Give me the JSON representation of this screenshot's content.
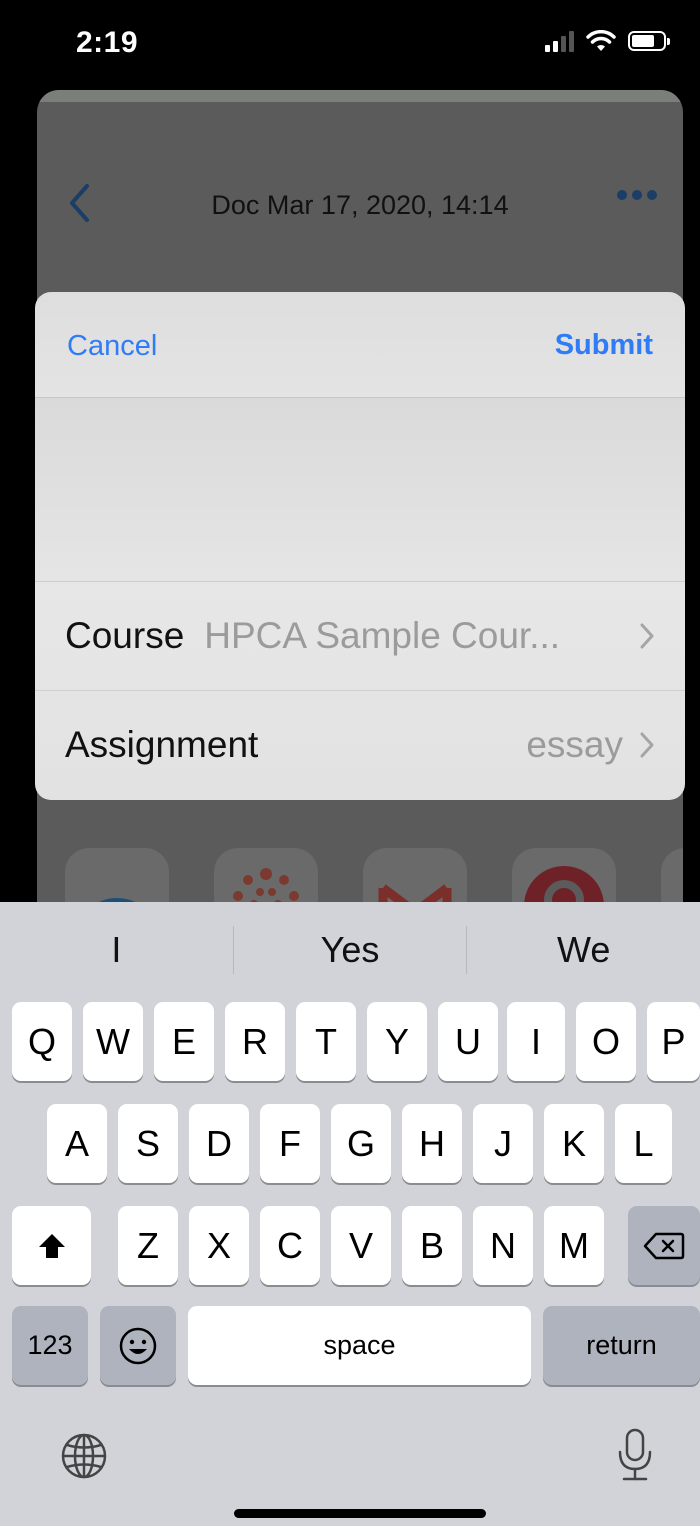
{
  "status_bar": {
    "time": "2:19",
    "signal_icon": "cellular-signal-icon",
    "wifi_icon": "wifi-icon",
    "battery_icon": "battery-icon"
  },
  "app": {
    "back_icon": "chevron-left-icon",
    "title": "Doc Mar 17, 2020, 14:14",
    "more_icon": "more-horizontal-icon",
    "share_apps": [
      "fingerprint-app-icon",
      "canvas-app-icon",
      "gmail-app-icon",
      "pinterest-app-icon",
      "chrome-app-icon"
    ]
  },
  "dialog": {
    "cancel_label": "Cancel",
    "submit_label": "Submit",
    "rows": [
      {
        "label": "Course",
        "value": "HPCA Sample Cour..."
      },
      {
        "label": "Assignment",
        "value": "essay"
      }
    ]
  },
  "keyboard": {
    "suggestions": [
      "I",
      "Yes",
      "We"
    ],
    "row1": [
      "Q",
      "W",
      "E",
      "R",
      "T",
      "Y",
      "U",
      "I",
      "O",
      "P"
    ],
    "row2": [
      "A",
      "S",
      "D",
      "F",
      "G",
      "H",
      "J",
      "K",
      "L"
    ],
    "row3": [
      "Z",
      "X",
      "C",
      "V",
      "B",
      "N",
      "M"
    ],
    "numbers_label": "123",
    "space_label": "space",
    "return_label": "return",
    "shift_icon": "shift-icon",
    "delete_icon": "delete-icon",
    "emoji_icon": "emoji-icon",
    "globe_icon": "globe-icon",
    "mic_icon": "microphone-icon"
  },
  "colors": {
    "accent": "#2f7cf6",
    "keyboard_bg": "#d1d3d9",
    "dimmed_sheet": "#5b5b5b"
  }
}
